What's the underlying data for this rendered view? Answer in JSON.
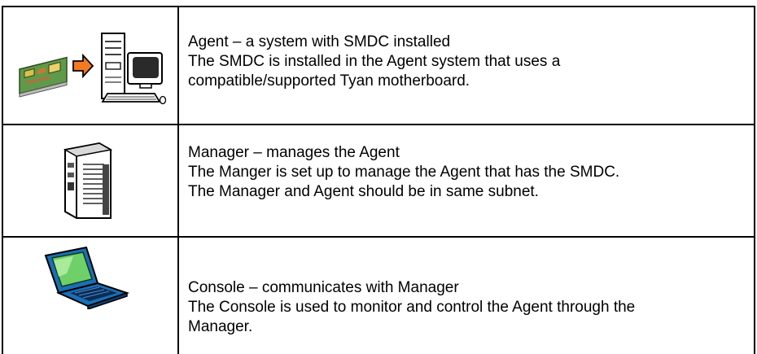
{
  "rows": [
    {
      "icon": "expansion-card-into-computer-icon",
      "title": "Agent – a system with SMDC installed",
      "line1": "The SMDC is installed in the Agent system that uses a",
      "line2": "compatible/supported Tyan motherboard."
    },
    {
      "icon": "tower-server-icon",
      "title": "Manager – manages the Agent",
      "line1": "The Manger is set up to manage the Agent that has the SMDC.",
      "line2": "The Manager and Agent should be in same subnet."
    },
    {
      "icon": "laptop-icon",
      "title": "Console – communicates with Manager",
      "line1": "The Console is used to monitor and control the Agent through the",
      "line2": "Manager."
    }
  ]
}
